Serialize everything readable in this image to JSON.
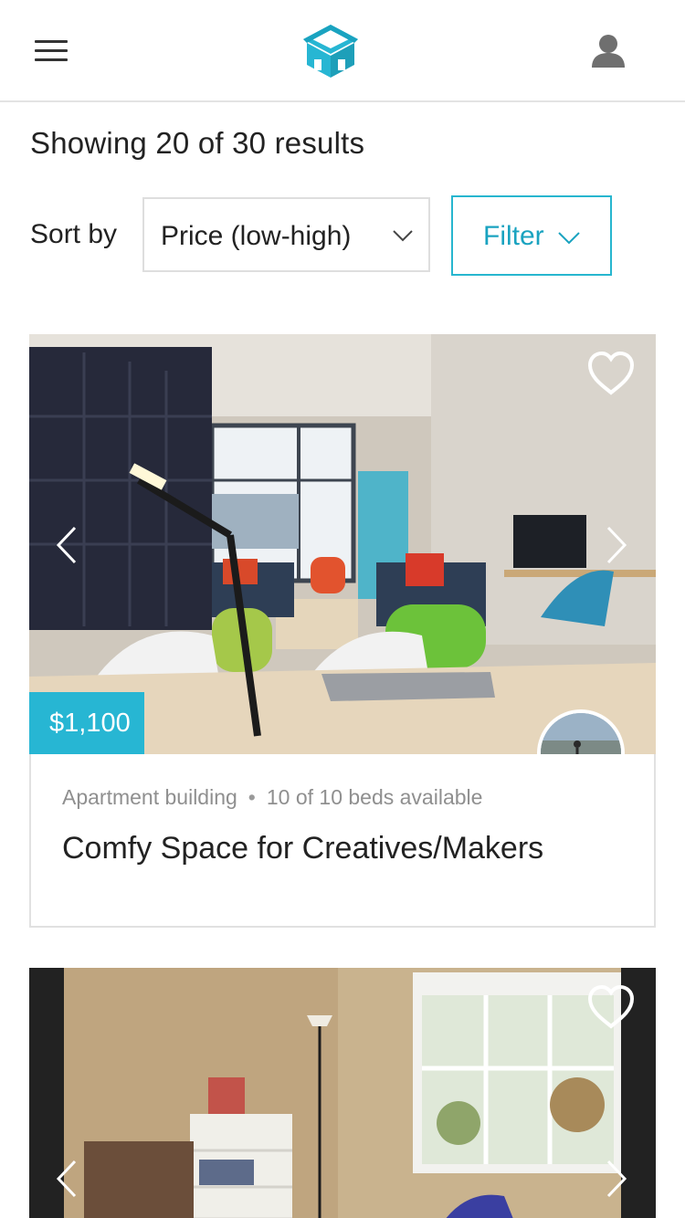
{
  "header": {
    "menu_icon": "hamburger-menu-icon",
    "logo_icon": "house-logo-icon",
    "profile_icon": "user-profile-icon",
    "accent_color": "#27b6d3"
  },
  "results": {
    "summary": "Showing 20 of 30 results"
  },
  "sort": {
    "label": "Sort by",
    "selected": "Price (low-high)"
  },
  "filter": {
    "label": "Filter"
  },
  "listings": [
    {
      "price": "$1,100",
      "type": "Apartment building",
      "availability": "10 of 10 beds available",
      "title": "Comfy Space for Creatives/Makers",
      "favorite_icon": "heart-outline-icon"
    },
    {
      "favorite_icon": "heart-outline-icon"
    }
  ]
}
